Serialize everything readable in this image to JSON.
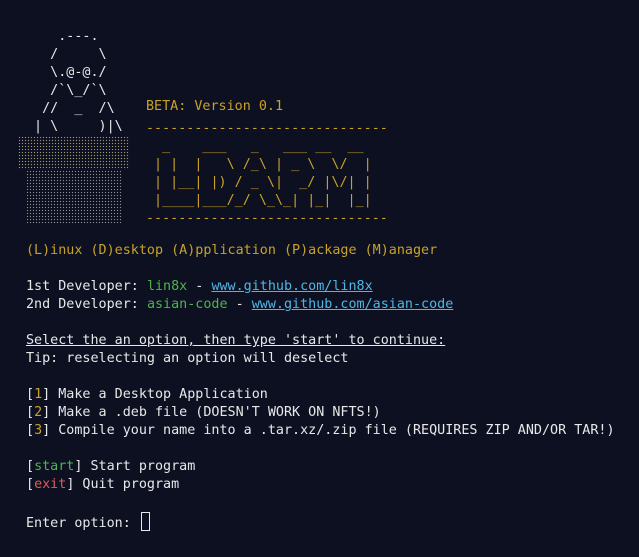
{
  "logo": {
    "tux_art": "    .---.\n   /     \\\n   \\.@-@./\n   /`\\_/`\\\n  //  _  /\\\n | \\     )|\\"
  },
  "banner": {
    "beta": "BETA: Version 0.1",
    "rule_top": "------------------------------",
    "art": "  _    ___   _   ___ __  __\n | |  |   \\ /_\\ | _ \\  \\/  |\n | |__| |) / _ \\|  _/ |\\/| |\n |____|___/_/ \\_\\_| |_|  |_|",
    "rule_bottom": "------------------------------"
  },
  "title": "(L)inux (D)esktop (A)pplication (P)ackage (M)anager",
  "developers": [
    {
      "label": "1st Developer: ",
      "name": "lin8x",
      "sep": " - ",
      "url": "www.github.com/lin8x"
    },
    {
      "label": "2nd Developer: ",
      "name": "asian-code",
      "sep": " - ",
      "url": "www.github.com/asian-code"
    }
  ],
  "instructions": {
    "heading": "Select the an option, then type 'start' to continue:",
    "tip": "Tip: reselecting an option will deselect"
  },
  "options": [
    {
      "key": "1",
      "label": " Make a Desktop Application"
    },
    {
      "key": "2",
      "label": " Make a .deb file (DOESN'T WORK ON NFTS!)"
    },
    {
      "key": "3",
      "label": " Compile your name into a .tar.xz/.zip file (REQUIRES ZIP AND/OR TAR!)"
    }
  ],
  "commands": [
    {
      "key": "start",
      "label": " Start program",
      "color": "#4fb34f"
    },
    {
      "key": "exit",
      "label": " Quit program",
      "color": "#e05a5a"
    }
  ],
  "prompt": {
    "label": "Enter option: ",
    "value": ""
  },
  "colors": {
    "background": "#0c1021",
    "text": "#e8e8e8",
    "accent_yellow": "#c9a227",
    "green": "#4fb34f",
    "red": "#e05a5a",
    "link": "#4fb7e6"
  }
}
